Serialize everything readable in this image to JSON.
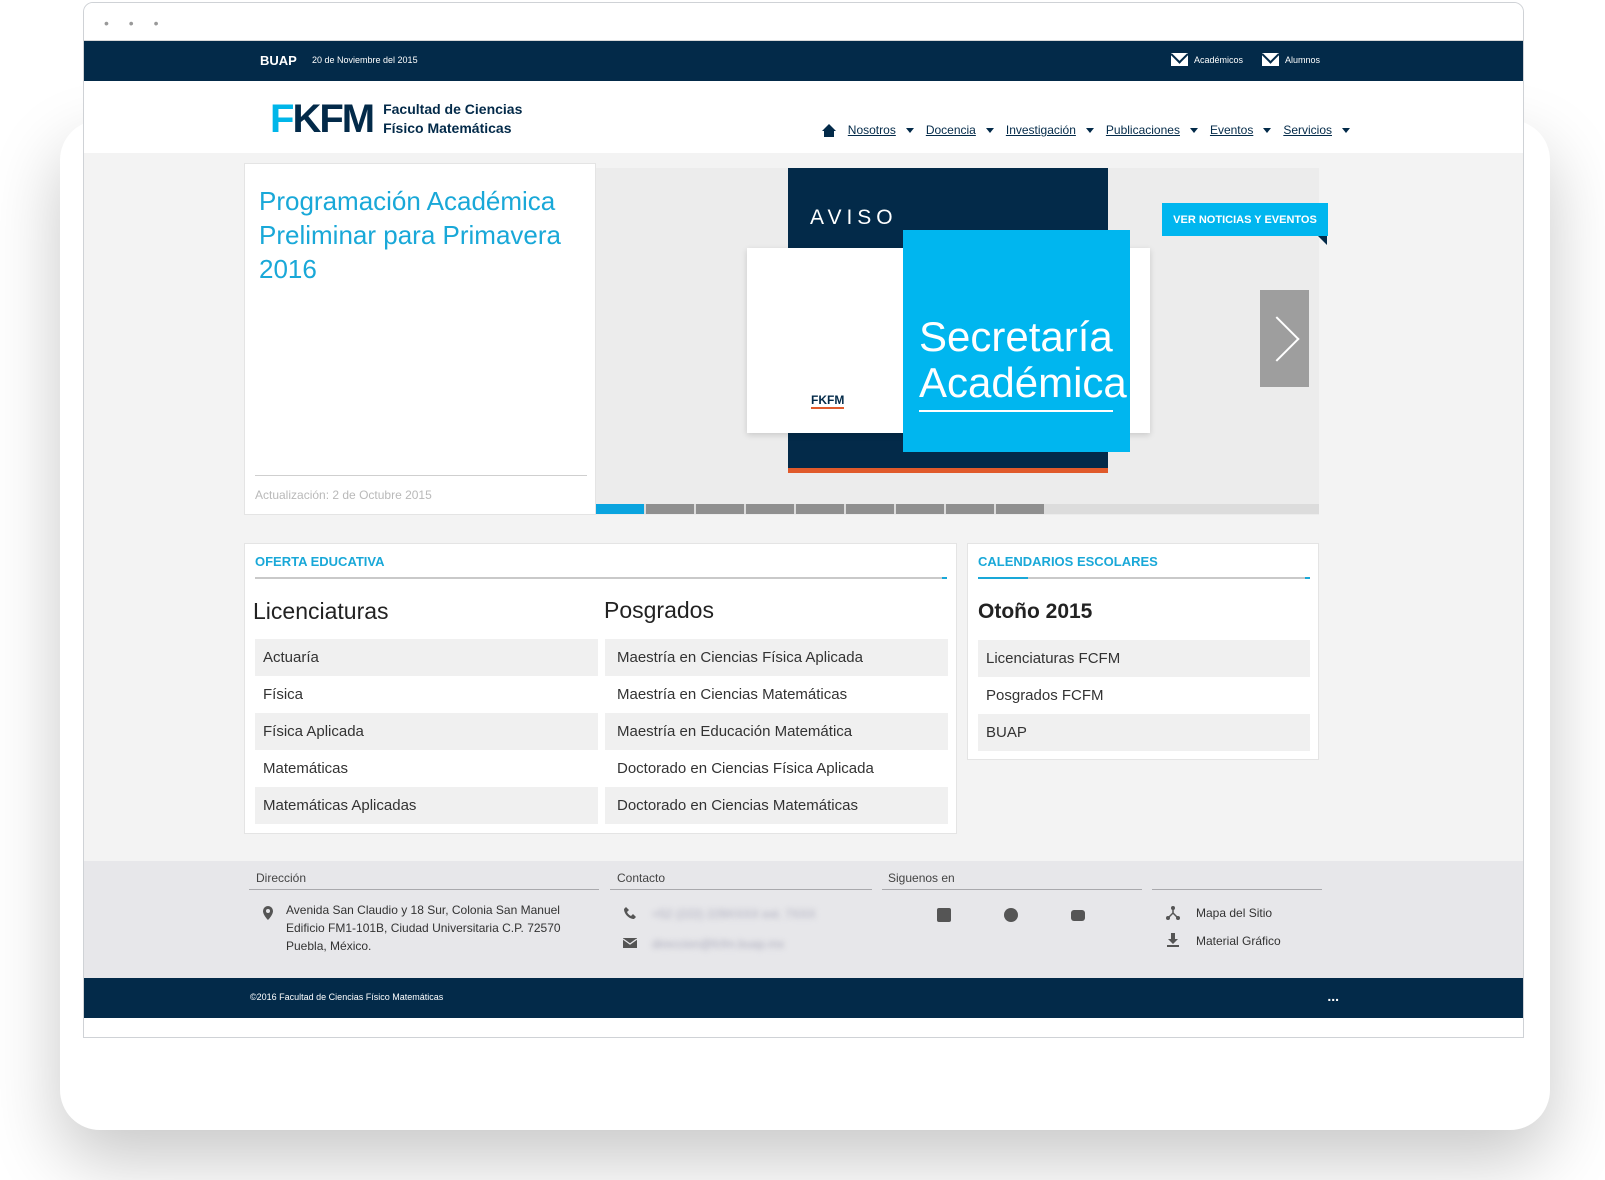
{
  "browser": {
    "dots": "• • •"
  },
  "topbar": {
    "brand": "BUAP",
    "date": "20 de Noviembre del 2015",
    "links": [
      "Académicos",
      "Alumnos"
    ]
  },
  "header": {
    "logo_mark_a": "F",
    "logo_mark_b": "K",
    "logo_mark_c": "FM",
    "logo_line1": "Facultad de Ciencias",
    "logo_line2": "Físico Matemáticas",
    "nav": [
      "Nosotros",
      "Docencia",
      "Investigación",
      "Publicaciones",
      "Eventos",
      "Servicios"
    ]
  },
  "hero": {
    "title": "Programación Académica Preliminar para Primavera 2016",
    "update": "Actualización: 2 de Octubre 2015",
    "poster_aviso": "AVISO",
    "poster_mini": "FKFM",
    "poster_title_1": "Secretaría",
    "poster_title_2": "Académica",
    "cta": "VER NOTICIAS Y EVENTOS",
    "slides_total": 9,
    "active_slide": 1
  },
  "oferta": {
    "heading": "OFERTA EDUCATIVA",
    "lic_title": "Licenciaturas",
    "lic_items": [
      "Actuaría",
      "Física",
      "Física Aplicada",
      "Matemáticas",
      "Matemáticas Aplicadas"
    ],
    "pos_title": "Posgrados",
    "pos_items": [
      "Maestría en Ciencias Física Aplicada",
      "Maestría en Ciencias Matemáticas",
      "Maestría en Educación Matemática",
      "Doctorado en Ciencias Física Aplicada",
      "Doctorado en Ciencias Matemáticas"
    ]
  },
  "calendarios": {
    "heading": "CALENDARIOS ESCOLARES",
    "title": "Otoño 2015",
    "items": [
      "Licenciaturas FCFM",
      "Posgrados FCFM",
      "BUAP"
    ]
  },
  "footer": {
    "dir_title": "Dirección",
    "address_1": "Avenida San Claudio y 18 Sur, Colonia San Manuel",
    "address_2": "Edificio FM1-101B, Ciudad Universitaria C.P. 72570",
    "address_3": "Puebla, México.",
    "contact_title": "Contacto",
    "phone": "+52 (222) 229XXXX ext. 7XXX",
    "email": "direccion@fcfm.buap.mx",
    "social_title": "Siguenos en",
    "site_map": "Mapa del Sitio",
    "material": "Material Gráfico",
    "copyright": "©2016 Facultad de Ciencias Físico Matemáticas",
    "more": "..."
  },
  "colors": {
    "navy": "#032a49",
    "accent": "#00b6ef",
    "orange": "#e05a2b"
  }
}
